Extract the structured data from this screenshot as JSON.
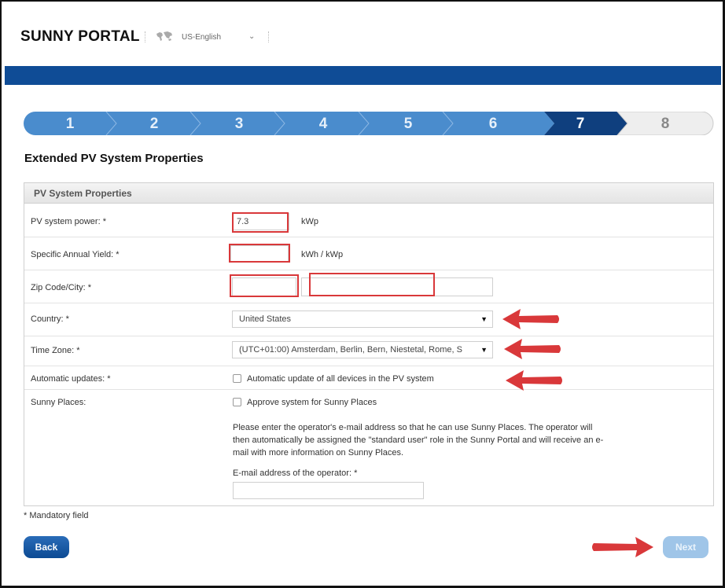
{
  "header": {
    "logo": "SUNNY PORTAL",
    "language": "US-English"
  },
  "steps": {
    "items": [
      "1",
      "2",
      "3",
      "4",
      "5",
      "6",
      "7",
      "8"
    ],
    "current": "7",
    "colors": {
      "completed": "#4a8ccd",
      "current": "#0f3f7e",
      "upcoming": "#eeeeee"
    }
  },
  "page": {
    "title": "Extended PV System Properties"
  },
  "panel": {
    "heading": "PV System Properties",
    "pv_power": {
      "label": "PV system power: *",
      "value": "7.3",
      "unit": "kWp"
    },
    "annual_yield": {
      "label": "Specific Annual Yield: *",
      "value": "",
      "unit": "kWh / kWp"
    },
    "zip_city": {
      "label": "Zip Code/City: *",
      "zip": "",
      "city": ""
    },
    "country": {
      "label": "Country: *",
      "selected": "United States"
    },
    "time_zone": {
      "label": "Time Zone: *",
      "selected": "(UTC+01:00) Amsterdam, Berlin, Bern, Niestetal, Rome, S"
    },
    "auto_updates": {
      "label": "Automatic updates: *",
      "checkbox_label": "Automatic update of all devices in the PV system"
    },
    "sunny_places": {
      "label": "Sunny Places:",
      "checkbox_label": "Approve system for Sunny Places",
      "info_line1": "Please enter the operator's e-mail address so that he can use Sunny Places. The operator will",
      "info_line2": "then automatically be assigned the \"standard user\" role in the Sunny Portal and will receive an e-",
      "info_line3": "mail with more information on Sunny Places.",
      "email_label": "E-mail address of the operator: *",
      "email_value": ""
    }
  },
  "footer": {
    "mandatory_note": "* Mandatory field",
    "back_label": "Back",
    "next_label": "Next"
  },
  "annotation_color": "#d9383a",
  "brand_color": "#0f4c96"
}
